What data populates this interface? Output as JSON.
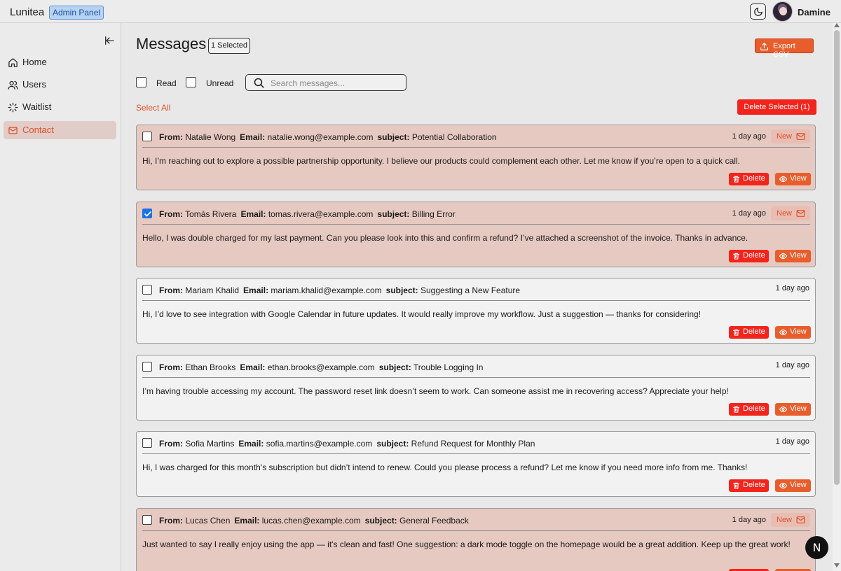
{
  "app": {
    "brand": "Lunitea",
    "badge": "Admin Panel",
    "username": "Damine"
  },
  "sidebar": {
    "items": [
      {
        "label": "Home",
        "icon": "home-icon"
      },
      {
        "label": "Users",
        "icon": "users-icon"
      },
      {
        "label": "Waitlist",
        "icon": "loader-icon"
      },
      {
        "label": "Contact",
        "icon": "mail-icon",
        "active": true
      }
    ]
  },
  "page": {
    "title": "Messages",
    "selected_count": "1 Selected",
    "export_label": "Export CSV",
    "filter_read": "Read",
    "filter_unread": "Unread",
    "search_placeholder": "Search messages...",
    "select_all": "Select All",
    "delete_selected": "Delete Selected (1)"
  },
  "labels": {
    "from": "From:",
    "email": "Email:",
    "subject": "subject:",
    "new": "New",
    "delete": "Delete",
    "view": "View"
  },
  "messages": [
    {
      "from": "Natalie Wong",
      "email": "natalie.wong@example.com",
      "subject": "Potential Collaboration",
      "date": "1 day ago",
      "is_new": true,
      "checked": false,
      "body": "Hi, I’m reaching out to explore a possible partnership opportunity. I believe our products could complement each other. Let me know if you’re open to a quick call."
    },
    {
      "from": "Tomás Rivera",
      "email": "tomas.rivera@example.com",
      "subject": "Billing Error",
      "date": "1 day ago",
      "is_new": true,
      "checked": true,
      "body": "Hello, I was double charged for my last payment. Can you please look into this and confirm a refund? I’ve attached a screenshot of the invoice. Thanks in advance."
    },
    {
      "from": "Mariam Khalid",
      "email": "mariam.khalid@example.com",
      "subject": "Suggesting a New Feature",
      "date": "1 day ago",
      "is_new": false,
      "checked": false,
      "body": "Hi, I’d love to see integration with Google Calendar in future updates. It would really improve my workflow. Just a suggestion — thanks for considering!"
    },
    {
      "from": "Ethan Brooks",
      "email": "ethan.brooks@example.com",
      "subject": "Trouble Logging In",
      "date": "1 day ago",
      "is_new": false,
      "checked": false,
      "body": "I’m having trouble accessing my account. The password reset link doesn’t seem to work. Can someone assist me in recovering access? Appreciate your help!"
    },
    {
      "from": "Sofia Martins",
      "email": "sofia.martins@example.com",
      "subject": "Refund Request for Monthly Plan",
      "date": "1 day ago",
      "is_new": false,
      "checked": false,
      "body": "Hi, I was charged for this month’s subscription but didn’t intend to renew. Could you please process a refund? Let me know if you need more info from me. Thanks!"
    },
    {
      "from": "Lucas Chen",
      "email": "lucas.chen@example.com",
      "subject": "General Feedback",
      "date": "1 day ago",
      "is_new": true,
      "checked": false,
      "body": "Just wanted to say I really enjoy using the app — it's clean and fast! One suggestion: a dark mode toggle on the homepage would be a great addition. Keep up the great work!"
    }
  ],
  "floating_badge": "N",
  "colors": {
    "accent": "#e85d2b",
    "danger": "#f2241c",
    "unread_bg": "#e6c9c1",
    "read_bg": "#f2f2f2"
  }
}
